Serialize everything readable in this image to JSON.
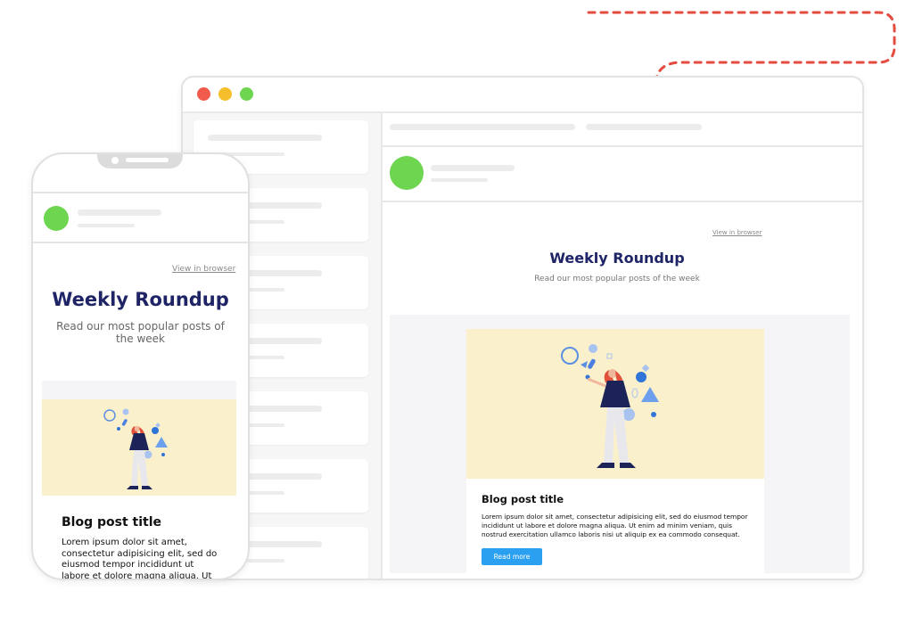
{
  "colors": {
    "accent_dash": "#e54b3f",
    "traffic_red": "#f25b4c",
    "traffic_yellow": "#f5be2a",
    "traffic_green": "#6dd54f",
    "avatar": "#6dd54f",
    "title": "#1e2466",
    "button": "#2b9ff0",
    "illustration_bg": "#fbf0cc"
  },
  "desktop": {
    "view_in_browser": "View in browser",
    "title": "Weekly Roundup",
    "subtitle": "Read our most popular posts of the week",
    "card": {
      "title": "Blog post title",
      "body": "Lorem ipsum dolor sit amet, consectetur adipisicing elit, sed do eiusmod tempor incididunt ut labore et dolore magna aliqua. Ut enim ad minim veniam, quis nostrud exercitation ullamco laboris nisi ut aliquip ex ea commodo consequat.",
      "button": "Read more"
    }
  },
  "mobile": {
    "view_in_browser": "View in browser",
    "title": "Weekly Roundup",
    "subtitle": "Read our most popular posts of the week",
    "card": {
      "title": "Blog post title",
      "body": "Lorem ipsum dolor sit amet, consectetur adipisicing elit, sed do eiusmod tempor incididunt ut labore et dolore magna aliqua. Ut enim ad minim"
    }
  },
  "icons": [
    "illustration-person-juggling-shapes",
    "avatar-placeholder"
  ]
}
